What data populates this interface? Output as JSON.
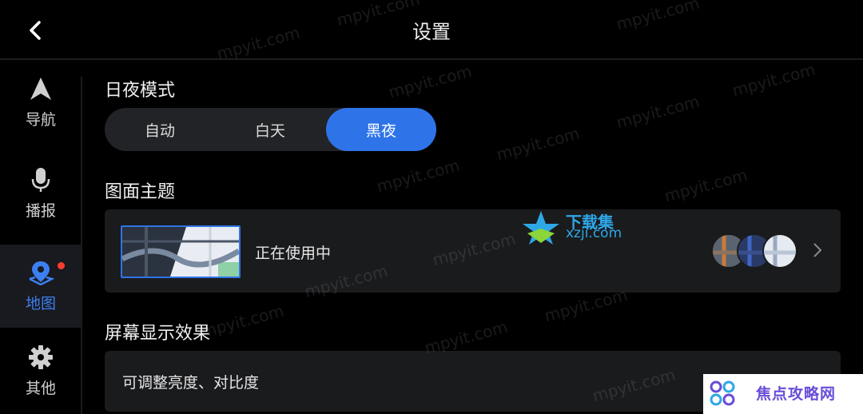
{
  "header": {
    "title": "设置"
  },
  "sidebar": {
    "items": [
      {
        "label": "导航",
        "icon": "navigation-arrow-icon",
        "active": false
      },
      {
        "label": "播报",
        "icon": "microphone-icon",
        "active": false
      },
      {
        "label": "地图",
        "icon": "map-pin-icon",
        "active": true,
        "badge": true
      },
      {
        "label": "其他",
        "icon": "gear-icon",
        "active": false
      }
    ]
  },
  "day_night": {
    "title": "日夜模式",
    "options": [
      "自动",
      "白天",
      "黑夜"
    ],
    "selected": "黑夜"
  },
  "map_theme": {
    "title": "图面主题",
    "status": "正在使用中"
  },
  "display": {
    "title": "屏幕显示效果",
    "row_label": "可调整亮度、对比度"
  },
  "watermark": {
    "text": "mpyit.com",
    "logo_text": "下载集",
    "logo_domain": "xzji.com",
    "corner_text": "焦点攻略网"
  },
  "colors": {
    "accent": "#2e74e8",
    "background": "#000000",
    "card": "#1a1b1d",
    "badge": "#ff3b30"
  }
}
